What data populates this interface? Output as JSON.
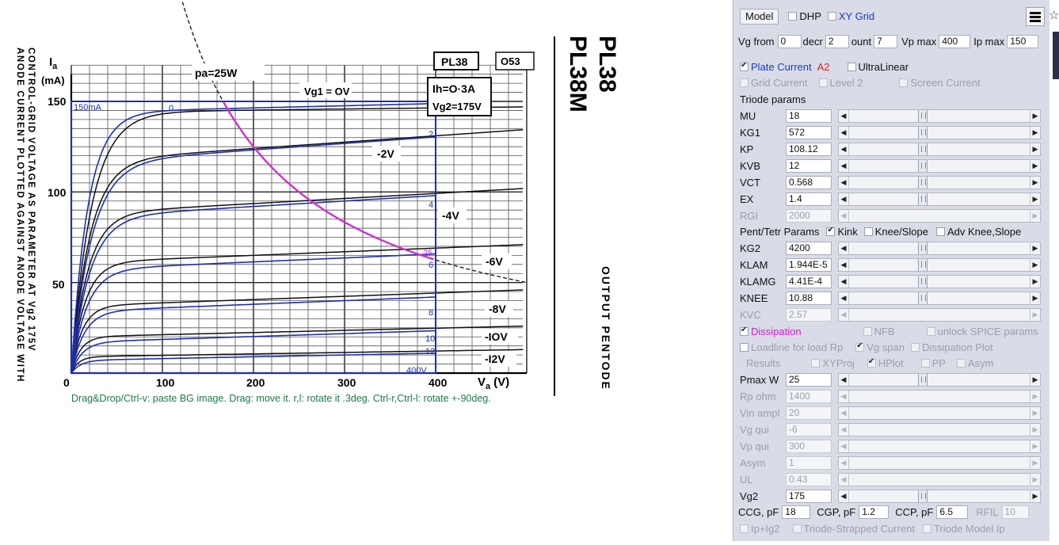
{
  "graph": {
    "title_vertical": "PL38",
    "subtitle_vertical": "PL38M",
    "side_label": "OUTPUT PENTODE",
    "left_caption_lines": [
      "ANODE CURRENT PLOTTED AGAINST ANODE VOLTAGE WITH",
      "CONTROL-GRID VOLTAGE AS PARAMETER AT Vg2 175V"
    ],
    "ia_label": "I",
    "ia_sub": "a",
    "ma_label": "(mA)",
    "va_label": "V",
    "va_sub": "a",
    "va_unit": "(V)",
    "x_ticks": [
      "0",
      "100",
      "200",
      "300",
      "400"
    ],
    "y_ticks": [
      "150",
      "100",
      "50"
    ],
    "pa_label": "pa=25W",
    "vg1_label": "Vg1 = OV",
    "header_box": "PL38",
    "code_box": "O53",
    "ih_label": "Ih=O·3A",
    "vg2_label": "Vg2=175V",
    "curve_labels": [
      "-2V",
      "-4V",
      "-6V",
      "-8V",
      "-IOV",
      "-I2V"
    ],
    "overlay_ma": "150mA",
    "overlay_v": "400V",
    "overlay_model_labels": [
      "0",
      "2",
      "4",
      "6",
      "8",
      "10",
      "12"
    ],
    "overlay_diss": "25",
    "help_text": "Drag&Drop/Ctrl-v: paste BG image. Drag: move it. r,l: rotate it .3deg. Ctrl-r,Ctrl-l: rotate +-90deg."
  },
  "panel": {
    "model_button": "Model",
    "dhp": "DHP",
    "xy_grid": "XY Grid",
    "vg_from_label": "Vg from",
    "vg_from": "0",
    "decr_label": "decr",
    "decr": "2",
    "count_label": "ount",
    "count": "7",
    "vp_max_label": "Vp max",
    "vp_max": "400",
    "ip_max_label": "Ip max",
    "ip_max": "150",
    "plate_current": "Plate Current",
    "a2": "A2",
    "ultralinear": "UltraLinear",
    "grid_current": "Grid Current",
    "level2": "Level 2",
    "screen_current": "Screen Current",
    "triode_params": "Triode params",
    "params": [
      {
        "name": "MU",
        "value": "18",
        "disabled": false
      },
      {
        "name": "KG1",
        "value": "572",
        "disabled": false
      },
      {
        "name": "KP",
        "value": "108.12",
        "disabled": false
      },
      {
        "name": "KVB",
        "value": "12",
        "disabled": false
      },
      {
        "name": "VCT",
        "value": "0.568",
        "disabled": false
      },
      {
        "name": "EX",
        "value": "1.4",
        "disabled": false
      },
      {
        "name": "RGI",
        "value": "2000",
        "disabled": true
      }
    ],
    "pent_params": "Pent/Tetr Params",
    "kink": "Kink",
    "knee_slope": "Knee/Slope",
    "adv_knee": "Adv Knee,Slope",
    "pent": [
      {
        "name": "KG2",
        "value": "4200",
        "disabled": false
      },
      {
        "name": "KLAM",
        "value": "1.944E-5",
        "disabled": false
      },
      {
        "name": "KLAMG",
        "value": "4.41E-4",
        "disabled": false
      },
      {
        "name": "KNEE",
        "value": "10.88",
        "disabled": false
      },
      {
        "name": "KVC",
        "value": "2.57",
        "disabled": true
      }
    ],
    "dissipation": "Dissipation",
    "nfb": "NFB",
    "unlock_spice": "unlock SPICE params",
    "loadline": "Loadline for load Rp",
    "vg_span": "Vg span",
    "diss_plot": "Dissipation Plot",
    "results": "Results",
    "xyproj": "XYProj",
    "hplot": "HPlot",
    "pp": "PP",
    "asym_cb": "Asym",
    "ops": [
      {
        "name": "Pmax W",
        "value": "25",
        "disabled": false
      },
      {
        "name": "Rp ohm",
        "value": "1400",
        "disabled": true
      },
      {
        "name": "Vin ampl",
        "value": "20",
        "disabled": true
      },
      {
        "name": "Vg qui",
        "value": "-6",
        "disabled": true
      },
      {
        "name": "Vp qui",
        "value": "300",
        "disabled": true
      },
      {
        "name": "Asym",
        "value": "1",
        "disabled": true
      },
      {
        "name": "UL",
        "value": "0.43",
        "disabled": true
      },
      {
        "name": "Vg2",
        "value": "175",
        "disabled": false
      }
    ],
    "ccg_label": "CCG, pF",
    "ccg": "18",
    "cgp_label": "CGP, pF",
    "cgp": "1.2",
    "ccp_label": "CCP, pF",
    "ccp": "6.5",
    "rfil_label": "RFIL",
    "rfil": "10",
    "ip_ig2": "Ip+Ig2",
    "triode_strapped": "Triode-Strapped Current",
    "triode_model_ip": "Triode Model Ip"
  },
  "colors": {
    "model_curve": "#1f2fb0",
    "diss_curve": "#cc33cc",
    "a2_red": "#e02020",
    "dissipation_magenta": "#cc22cc",
    "link_blue": "#1a3ad0",
    "help_green": "#1e7a4a"
  }
}
